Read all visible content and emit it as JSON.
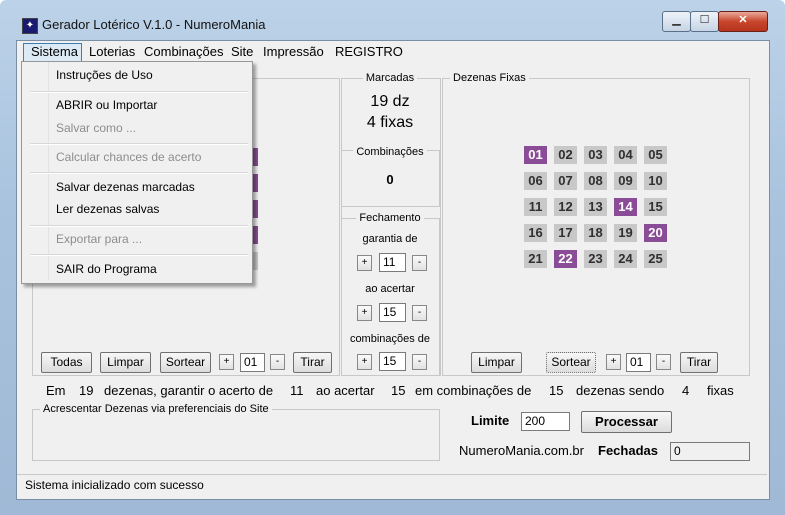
{
  "window": {
    "title": "Gerador Lotérico V.1.0 - NumeroMania"
  },
  "menu": [
    "Sistema",
    "Loterias",
    "Combinações",
    "Site",
    "Impressão",
    "REGISTRO"
  ],
  "dropdown": {
    "items": [
      {
        "label": "Instruções de Uso",
        "enabled": true
      },
      {
        "label": "ABRIR ou Importar",
        "enabled": true
      },
      {
        "label": "Salvar como ...",
        "enabled": false
      },
      {
        "label": "Calcular chances de acerto",
        "enabled": false
      },
      {
        "label": "Salvar dezenas marcadas",
        "enabled": true
      },
      {
        "label": "Ler dezenas salvas",
        "enabled": true
      },
      {
        "label": "Exportar para ...",
        "enabled": false
      },
      {
        "label": "SAIR do Programa",
        "enabled": true
      }
    ]
  },
  "left": {
    "buttons": {
      "todas": "Todas",
      "limpar": "Limpar",
      "sortear": "Sortear",
      "tirar": "Tirar",
      "plus": "+",
      "minus": "-"
    },
    "count": "01"
  },
  "middle": {
    "marcadas": {
      "label": "Marcadas",
      "dz": "19 dz",
      "fixas": "4 fixas"
    },
    "combinacoes": {
      "label": "Combinações",
      "value": "0"
    },
    "fechamento": {
      "label": "Fechamento",
      "garantia_label": "garantia de",
      "garantia_value": "11",
      "acertar_label": "ao acertar",
      "acertar_value": "15",
      "combinacoes_label": "combinações de",
      "combinacoes_value": "15",
      "plus": "+",
      "minus": "-"
    }
  },
  "fixas": {
    "label": "Dezenas Fixas",
    "numbers": [
      "01",
      "02",
      "03",
      "04",
      "05",
      "06",
      "07",
      "08",
      "09",
      "10",
      "11",
      "12",
      "13",
      "14",
      "15",
      "16",
      "17",
      "18",
      "19",
      "20",
      "21",
      "22",
      "23",
      "24",
      "25"
    ],
    "selected": [
      "01",
      "14",
      "20",
      "22"
    ],
    "buttons": {
      "limpar": "Limpar",
      "sortear": "Sortear",
      "tirar": "Tirar",
      "plus": "+",
      "minus": "-"
    },
    "count": "01"
  },
  "summary": {
    "em": "Em",
    "dezenas_count": "19",
    "dezenas_text": "dezenas, garantir o acerto de",
    "garantia": "11",
    "ao_acertar": "ao acertar",
    "acertar": "15",
    "em_combinacoes": "em combinações de",
    "combinacoes": "15",
    "dezenas_sendo": "dezenas sendo",
    "fixas_count": "4",
    "fixas": "fixas"
  },
  "preferenciais": {
    "label": "Acrescentar Dezenas via preferenciais do Site"
  },
  "limite": {
    "label": "Limite",
    "value": "200",
    "processar": "Processar"
  },
  "site": {
    "label": "NumeroMania.com.br",
    "fechadas_label": "Fechadas",
    "fechadas_value": "0"
  },
  "status": {
    "text": "Sistema inicializado com sucesso"
  }
}
